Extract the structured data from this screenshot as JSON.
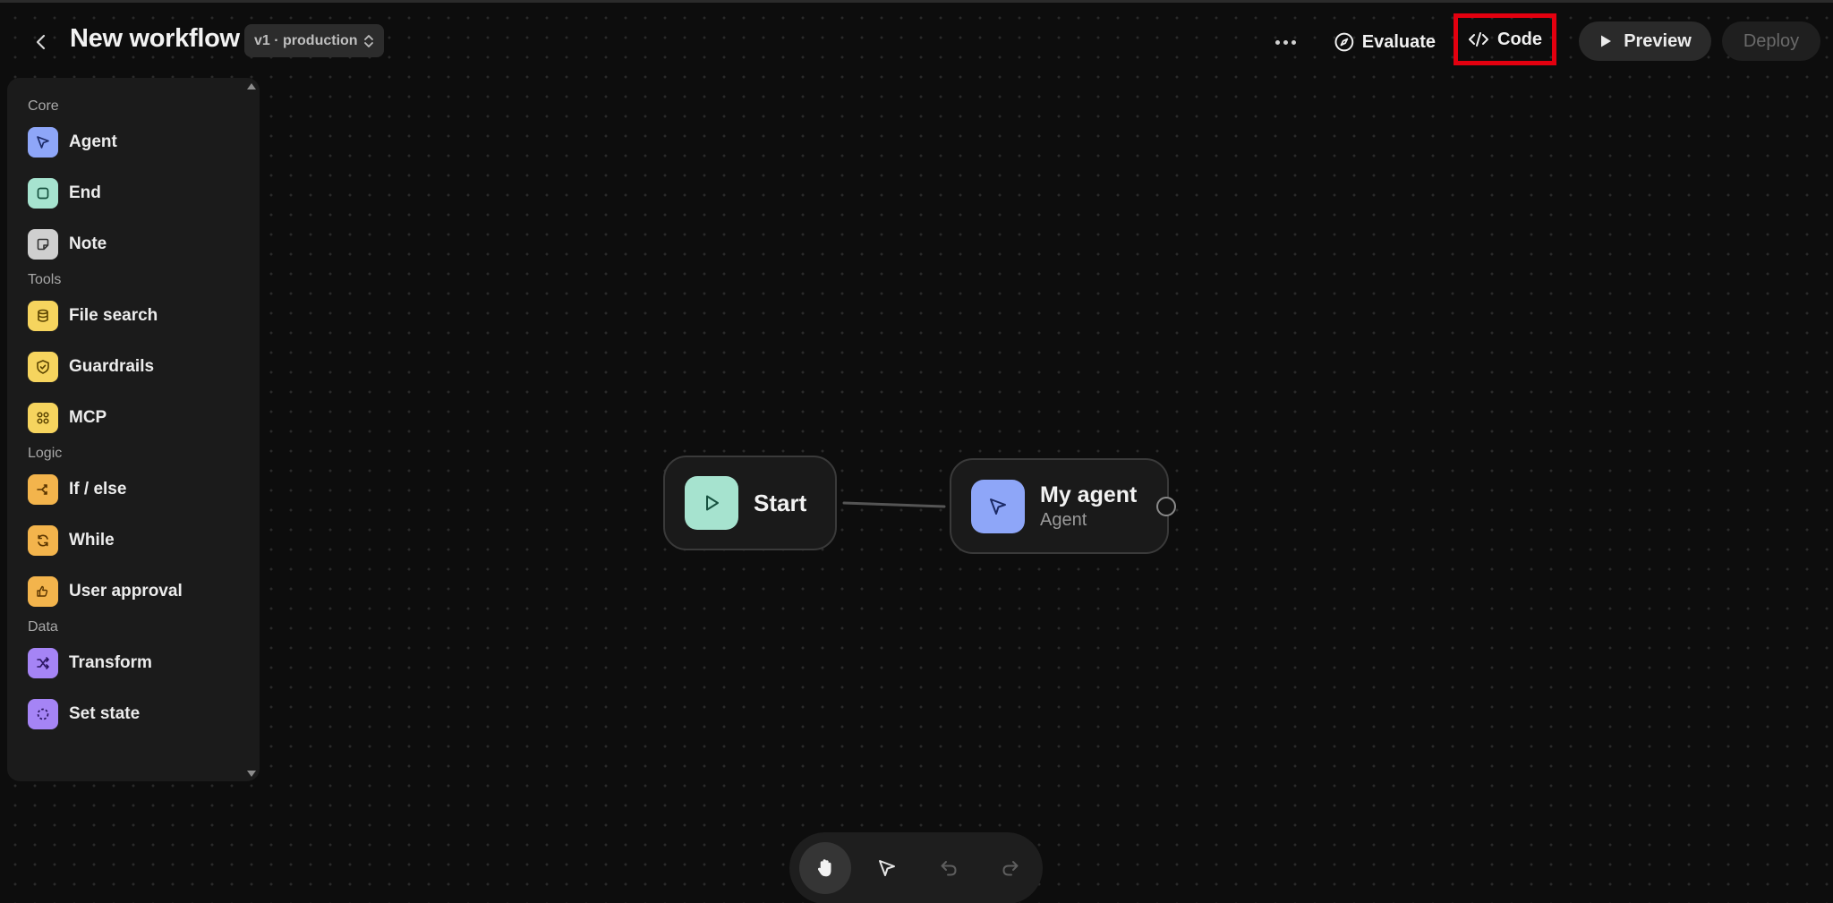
{
  "header": {
    "back_icon": "chevron-left-icon",
    "title": "New workflow",
    "version": "v1 · production",
    "more_icon": "more-horizontal-icon",
    "evaluate_label": "Evaluate",
    "code_label": "Code",
    "preview_label": "Preview",
    "deploy_label": "Deploy",
    "highlight_color": "#e3000f"
  },
  "sidebar": {
    "sections": [
      {
        "label": "Core",
        "items": [
          {
            "label": "Agent",
            "icon": "cursor-arrow-icon",
            "color": "#8ea6f8"
          },
          {
            "label": "End",
            "icon": "square-icon",
            "color": "#a6e3cf"
          },
          {
            "label": "Note",
            "icon": "sticky-note-icon",
            "color": "#cfcfcf"
          }
        ]
      },
      {
        "label": "Tools",
        "items": [
          {
            "label": "File search",
            "icon": "database-icon",
            "color": "#f6d45e"
          },
          {
            "label": "Guardrails",
            "icon": "shield-check-icon",
            "color": "#f6d45e"
          },
          {
            "label": "MCP",
            "icon": "mcp-icon",
            "color": "#f6d45e"
          }
        ]
      },
      {
        "label": "Logic",
        "items": [
          {
            "label": "If / else",
            "icon": "branch-icon",
            "color": "#f3b44c"
          },
          {
            "label": "While",
            "icon": "loop-icon",
            "color": "#f3b44c"
          },
          {
            "label": "User approval",
            "icon": "thumbs-icon",
            "color": "#f3b44c"
          }
        ]
      },
      {
        "label": "Data",
        "items": [
          {
            "label": "Transform",
            "icon": "shuffle-icon",
            "color": "#a584f5"
          },
          {
            "label": "Set state",
            "icon": "dashed-circle-icon",
            "color": "#a584f5"
          }
        ]
      }
    ]
  },
  "canvas": {
    "start_node": {
      "title": "Start",
      "icon": "play-icon",
      "color": "#a6e3cf"
    },
    "agent_node": {
      "title": "My agent",
      "subtitle": "Agent",
      "icon": "cursor-arrow-icon",
      "color": "#8ea6f8"
    }
  },
  "toolbar": {
    "tools": [
      {
        "name": "pan",
        "icon": "hand-icon",
        "active": true
      },
      {
        "name": "select",
        "icon": "cursor-arrow-icon",
        "active": false
      },
      {
        "name": "undo",
        "icon": "undo-icon",
        "active": false
      },
      {
        "name": "redo",
        "icon": "redo-icon",
        "active": false
      }
    ]
  }
}
